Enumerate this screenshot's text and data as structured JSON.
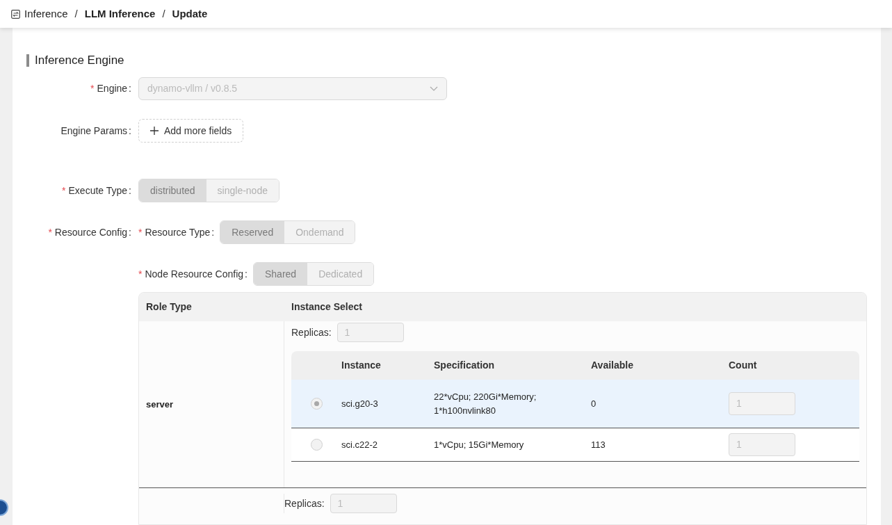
{
  "breadcrumb": [
    {
      "label": "Inference",
      "bold": false
    },
    {
      "label": "LLM Inference",
      "bold": true
    },
    {
      "label": "Update",
      "bold": true
    }
  ],
  "breadcrumb_separator": "/",
  "section_title": "Inference Engine",
  "engine": {
    "required_mark": "*",
    "label": "Engine",
    "colon": ":",
    "value": "dynamo-vllm / v0.8.5",
    "disabled": true
  },
  "engine_params": {
    "label": "Engine Params",
    "colon": ":",
    "button": "Add more fields"
  },
  "execute_type": {
    "required_mark": "*",
    "label": "Execute Type",
    "colon": ":",
    "options": [
      {
        "label": "distributed",
        "selected": true
      },
      {
        "label": "single-node",
        "selected": false
      }
    ]
  },
  "resource_config": {
    "required_mark": "*",
    "label": "Resource Config",
    "colon": ":",
    "resource_type": {
      "required_mark": "*",
      "label": "Resource Type",
      "colon": ":",
      "options": [
        {
          "label": "Reserved",
          "selected": true
        },
        {
          "label": "Ondemand",
          "selected": false
        }
      ]
    },
    "node_resource_config": {
      "required_mark": "*",
      "label": "Node Resource Config",
      "colon": ":",
      "options": [
        {
          "label": "Shared",
          "selected": true
        },
        {
          "label": "Dedicated",
          "selected": false
        }
      ]
    }
  },
  "roles_table": {
    "columns": [
      "Role Type",
      "Instance Select"
    ],
    "rows": [
      {
        "role": "server",
        "replicas_label": "Replicas:",
        "replicas_value": "1",
        "instances": {
          "columns": [
            "Instance",
            "Specification",
            "Available",
            "Count"
          ],
          "rows": [
            {
              "selected": true,
              "instance": "sci.g20-3",
              "specification": "22*vCpu; 220Gi*Memory; 1*h100nvlink80",
              "available": "0",
              "count": "1"
            },
            {
              "selected": false,
              "instance": "sci.c22-2",
              "specification": "1*vCpu; 15Gi*Memory",
              "available": "113",
              "count": "1"
            }
          ]
        }
      },
      {
        "replicas_label": "Replicas:",
        "replicas_value": "1"
      }
    ]
  }
}
